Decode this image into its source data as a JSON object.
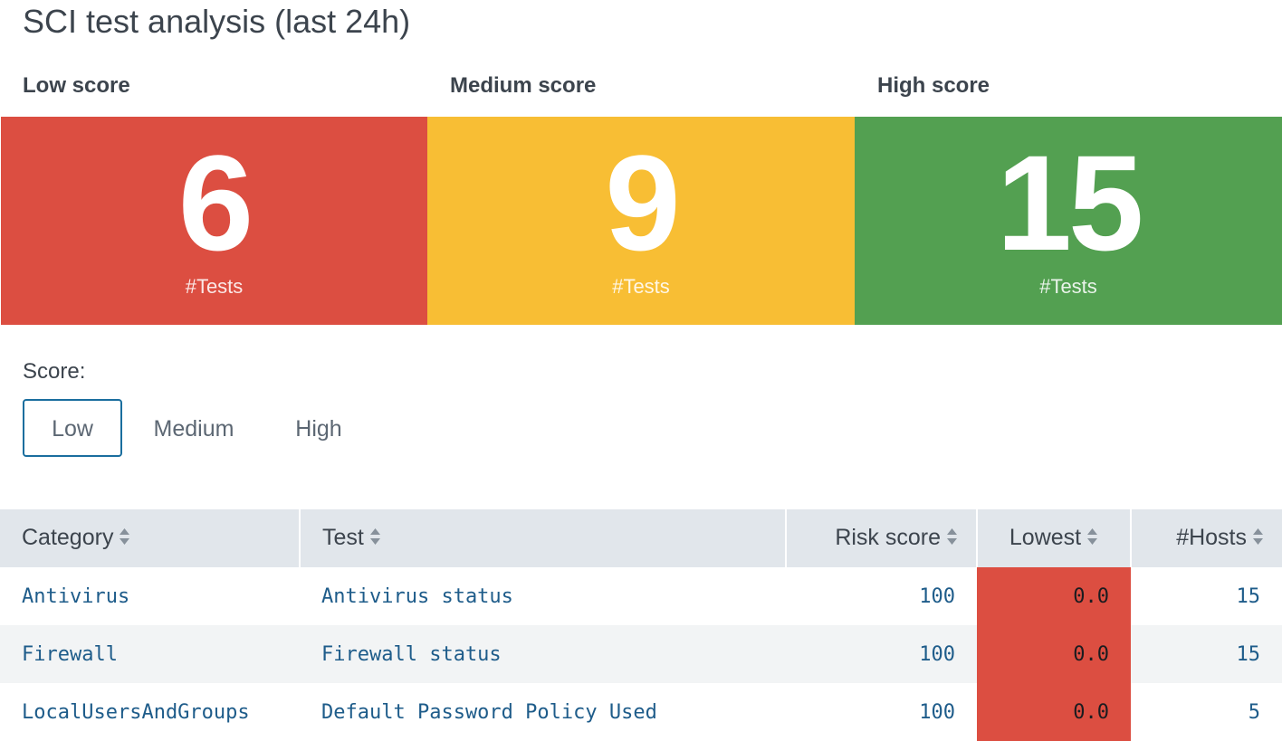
{
  "page": {
    "title": "SCI test analysis (last 24h)"
  },
  "score_tiles": [
    {
      "label": "Low score",
      "value": "6",
      "unit": "#Tests",
      "color": "#dc4e41"
    },
    {
      "label": "Medium score",
      "value": "9",
      "unit": "#Tests",
      "color": "#f8be34"
    },
    {
      "label": "High score",
      "value": "15",
      "unit": "#Tests",
      "color": "#53a051"
    }
  ],
  "score_filter": {
    "label": "Score:",
    "options": [
      "Low",
      "Medium",
      "High"
    ],
    "selected": "Low"
  },
  "table": {
    "columns": [
      "Category",
      "Test",
      "Risk score",
      "Lowest",
      "#Hosts"
    ],
    "rows": [
      {
        "category": "Antivirus",
        "test": "Antivirus status",
        "risk_score": "100",
        "lowest": "0.0",
        "hosts": "15"
      },
      {
        "category": "Firewall",
        "test": "Firewall status",
        "risk_score": "100",
        "lowest": "0.0",
        "hosts": "15"
      },
      {
        "category": "LocalUsersAndGroups",
        "test": "Default Password Policy Used",
        "risk_score": "100",
        "lowest": "0.0",
        "hosts": "5"
      }
    ]
  },
  "colors": {
    "low": "#dc4e41",
    "medium": "#f8be34",
    "high": "#53a051",
    "link": "#1e5c8a",
    "active_border": "#1a6e9e"
  }
}
